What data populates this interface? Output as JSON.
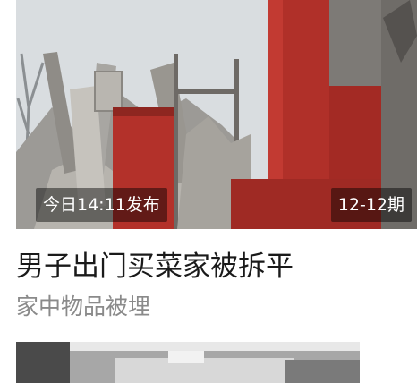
{
  "article": {
    "time_badge": "今日14:11发布",
    "issue_badge": "12-12期",
    "title": "男子出门买菜家被拆平",
    "subtitle": "家中物品被埋"
  }
}
